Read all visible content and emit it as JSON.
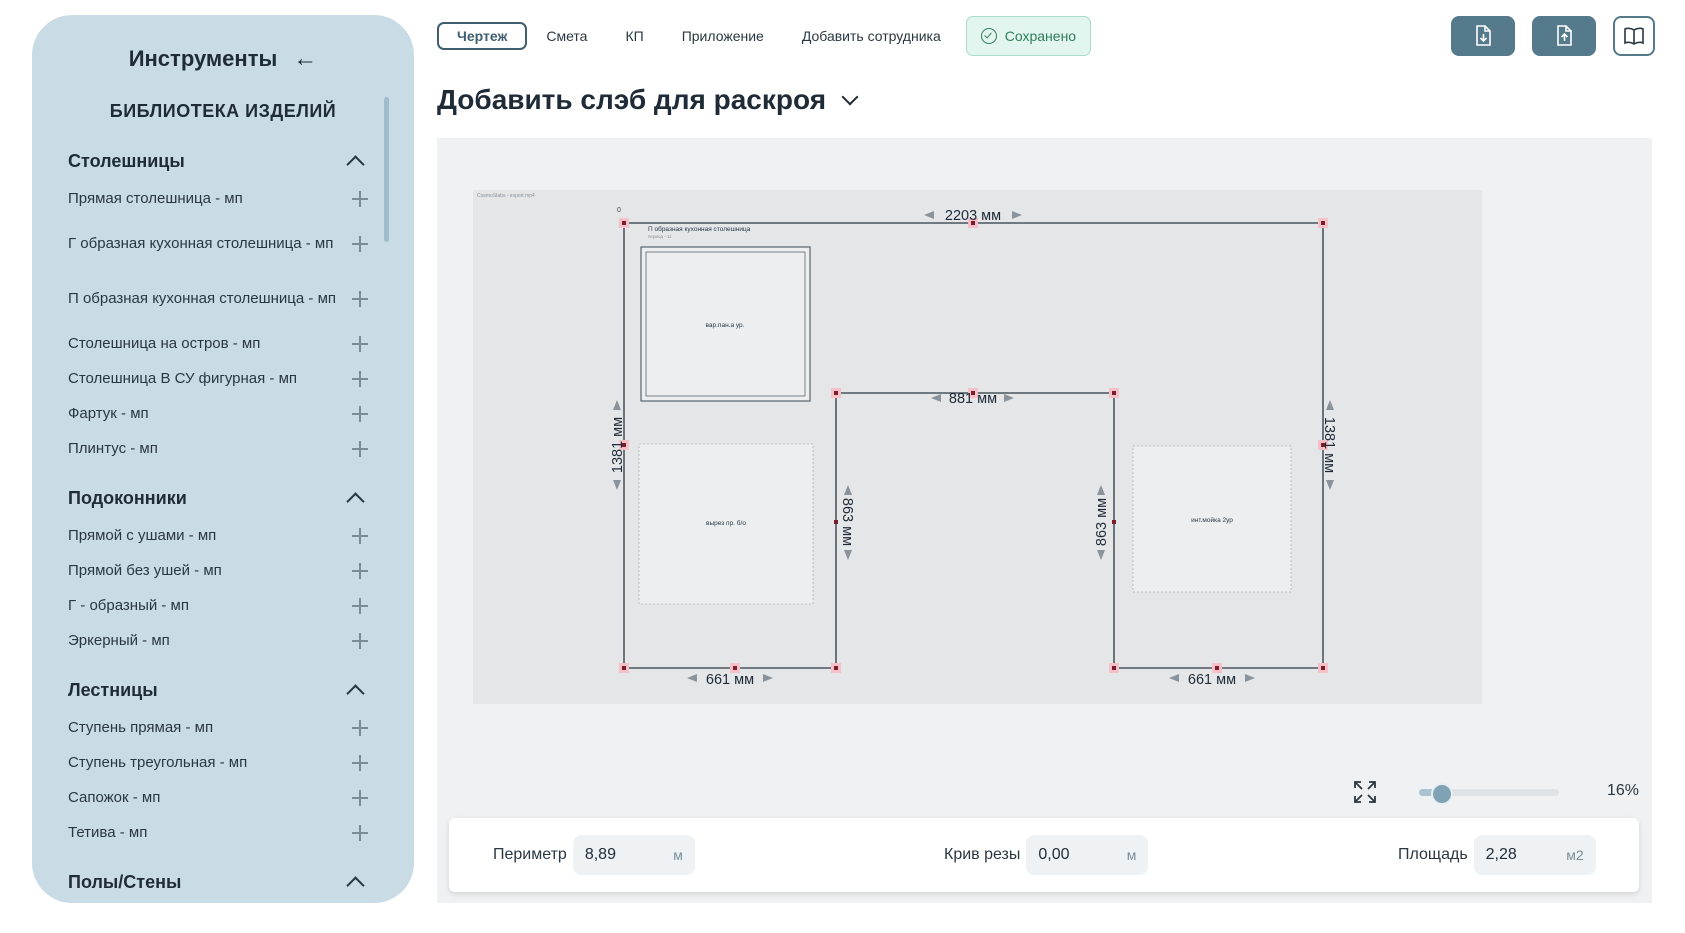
{
  "sidebar": {
    "title": "Инструменты",
    "back_icon": "←",
    "library_title": "БИБЛИОТЕКА ИЗДЕЛИЙ",
    "categories": [
      {
        "label": "Столешницы",
        "items": [
          {
            "label": "Прямая столешница - мп"
          },
          {
            "label": "Г образная кухонная столешница - мп"
          },
          {
            "label": "П образная кухонная столешница - мп"
          },
          {
            "label": "Столешница на остров - мп"
          },
          {
            "label": "Столешница В СУ фигурная - мп"
          },
          {
            "label": "Фартук - мп"
          },
          {
            "label": "Плинтус - мп"
          }
        ]
      },
      {
        "label": "Подоконники",
        "items": [
          {
            "label": "Прямой с ушами - мп"
          },
          {
            "label": "Прямой без ушей - мп"
          },
          {
            "label": "Г - образный - мп"
          },
          {
            "label": "Эркерный - мп"
          }
        ]
      },
      {
        "label": "Лестницы",
        "items": [
          {
            "label": "Ступень прямая - мп"
          },
          {
            "label": "Ступень треугольная - мп"
          },
          {
            "label": "Сапожок - мп"
          },
          {
            "label": "Тетива - мп"
          }
        ]
      },
      {
        "label": "Полы/Стены",
        "items": []
      }
    ]
  },
  "tabs": [
    {
      "label": "Чертеж",
      "active": true
    },
    {
      "label": "Смета"
    },
    {
      "label": "КП"
    },
    {
      "label": "Приложение"
    },
    {
      "label": "Добавить сотрудника"
    }
  ],
  "saved_label": "Сохранено",
  "toolbar_icons": [
    "download-file-icon",
    "upload-file-icon",
    "book-icon"
  ],
  "page_title": "Добавить слэб для раскроя",
  "drawing": {
    "watermark": "CosmoSlabs - export.mp4",
    "shape_title": "П образная кухонная столешница",
    "shape_subtitle": "период - 11",
    "origin_label": "0",
    "dim_top": "2203 мм",
    "dim_inner_top": "881 мм",
    "dim_left": "1381 мм",
    "dim_right": "1381 мм",
    "dim_inner_left": "863 мм",
    "dim_inner_right": "863 мм",
    "dim_bottom_left": "661 мм",
    "dim_bottom_right": "661 мм",
    "cutouts": [
      {
        "label": "вар.пан.а ур."
      },
      {
        "label": "вырез пр. б/о"
      },
      {
        "label": "инт.мойка 2ур"
      }
    ]
  },
  "zoom": {
    "value": "16%",
    "level": 0.16
  },
  "measurements": {
    "perimeter": {
      "label": "Периметр",
      "value": "8,89",
      "unit": "м"
    },
    "curved": {
      "label": "Крив резы",
      "value": "0,00",
      "unit": "м"
    },
    "area": {
      "label": "Площадь",
      "value": "2,28",
      "unit": "м2"
    }
  },
  "colors": {
    "sidebar_bg": "#c9dce6",
    "accent": "#557a8b",
    "saved_bg": "#e3f5ef",
    "saved_text": "#2e7d5a",
    "canvas_bg": "#f0f1f2",
    "drawing_bg": "#e4e6e8"
  }
}
